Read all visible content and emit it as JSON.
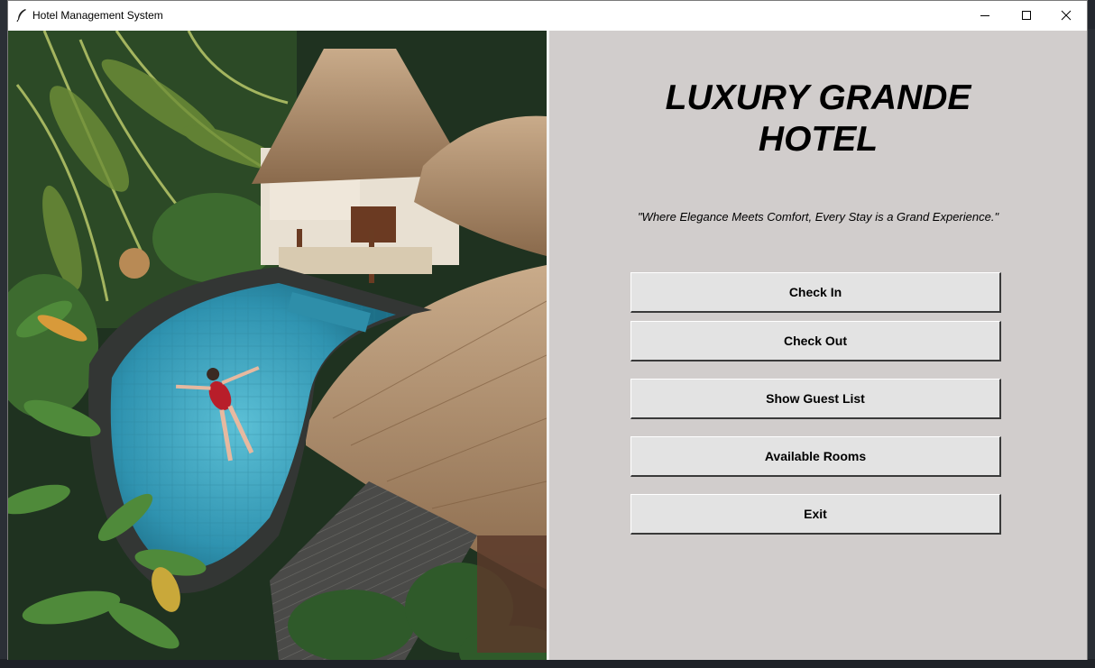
{
  "window": {
    "title": "Hotel Management System",
    "controls": {
      "minimize": "minimize-icon",
      "maximize": "maximize-icon",
      "close": "close-icon"
    }
  },
  "hero_image": {
    "subject": "tropical resort pool with thatched huts and palm trees"
  },
  "header": {
    "title_line1": "LUXURY GRANDE",
    "title_line2": "HOTEL",
    "tagline": "\"Where Elegance Meets Comfort, Every Stay is a Grand Experience.\""
  },
  "menu": {
    "buttons": [
      {
        "label": "Check In"
      },
      {
        "label": "Check Out"
      },
      {
        "label": "Show Guest List"
      },
      {
        "label": "Available Rooms"
      },
      {
        "label": "Exit"
      }
    ]
  },
  "colors": {
    "panel_bg": "#d1cdcc",
    "button_bg": "#e3e3e3",
    "pool_water": "#3fa3bd"
  }
}
